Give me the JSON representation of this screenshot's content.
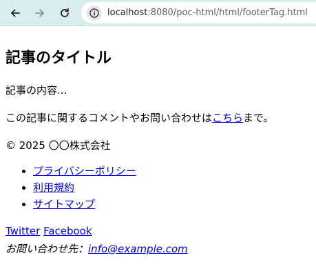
{
  "browser": {
    "url_host": "localhost",
    "url_rest": ":8080/poc-html/html/footerTag.html",
    "icons": [
      "back-icon",
      "forward-icon",
      "reload-icon",
      "site-info-icon"
    ]
  },
  "article": {
    "title": "記事のタイトル",
    "body": "記事の内容...",
    "comment_prefix": "この記事に関するコメントやお問い合わせは",
    "comment_link": "こちら",
    "comment_suffix": "まで。"
  },
  "footer": {
    "copyright": "© 2025 〇〇株式会社",
    "links": [
      {
        "label": "プライバシーポリシー"
      },
      {
        "label": "利用規約"
      },
      {
        "label": "サイトマップ"
      }
    ],
    "social": {
      "twitter": "Twitter",
      "facebook": "Facebook"
    },
    "contact_label": "お問い合わせ先：",
    "contact_email": "info@example.com"
  },
  "colors": {
    "link": "#0000ee",
    "toolbar_bg": "#d9ecee"
  }
}
